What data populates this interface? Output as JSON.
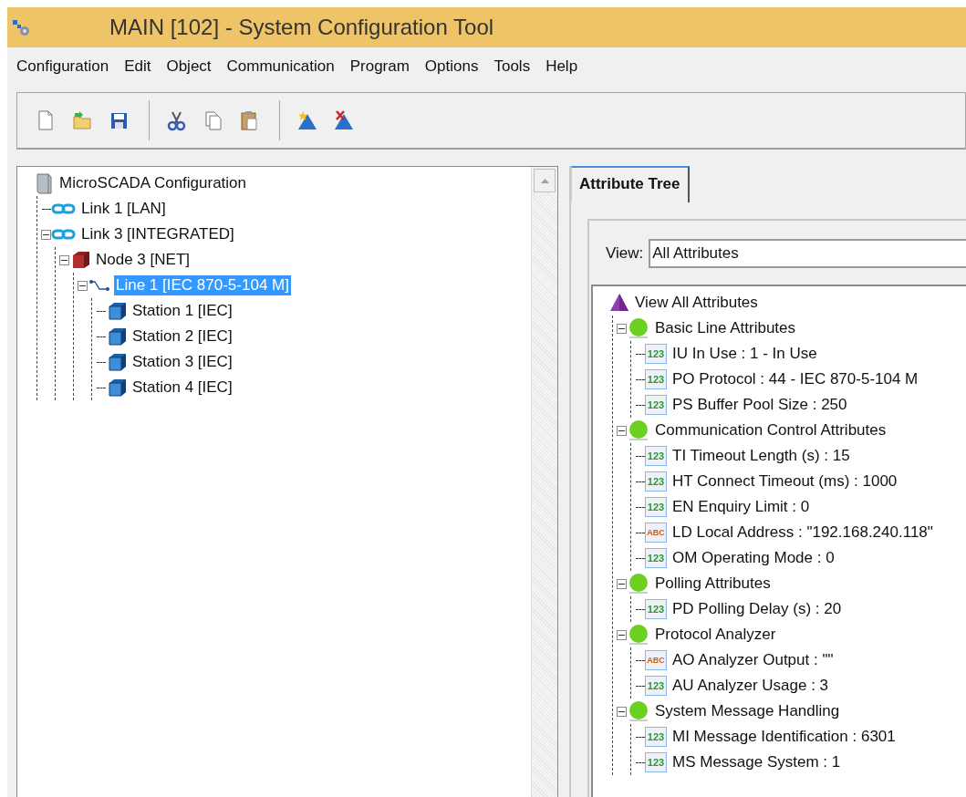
{
  "window": {
    "title": "MAIN [102] - System Configuration Tool"
  },
  "menu": [
    {
      "label": "Configuration"
    },
    {
      "label": "Edit"
    },
    {
      "label": "Object"
    },
    {
      "label": "Communication"
    },
    {
      "label": "Program"
    },
    {
      "label": "Options"
    },
    {
      "label": "Tools"
    },
    {
      "label": "Help"
    }
  ],
  "toolbar": [
    {
      "kind": "new"
    },
    {
      "kind": "open"
    },
    {
      "kind": "save"
    },
    {
      "kind": "separator"
    },
    {
      "kind": "cut"
    },
    {
      "kind": "copy"
    },
    {
      "kind": "paste"
    },
    {
      "kind": "separator"
    },
    {
      "kind": "add"
    },
    {
      "kind": "delete"
    }
  ],
  "config_tree": [
    {
      "label": "MicroSCADA Configuration",
      "kind": "computer",
      "selected": false,
      "children": [
        {
          "label": "Link 1 [LAN]",
          "kind": "link",
          "selected": false
        },
        {
          "label": "Link 3 [INTEGRATED]",
          "kind": "link",
          "selected": false,
          "expanded": true,
          "children": [
            {
              "label": "Node 3 [NET]",
              "kind": "node",
              "selected": false,
              "expanded": true,
              "children": [
                {
                  "label": "Line 1 [IEC 870-5-104 M]",
                  "kind": "line",
                  "selected": true,
                  "expanded": true,
                  "children": [
                    {
                      "label": "Station 1 [IEC]",
                      "kind": "station",
                      "selected": false
                    },
                    {
                      "label": "Station 2 [IEC]",
                      "kind": "station",
                      "selected": false
                    },
                    {
                      "label": "Station 3 [IEC]",
                      "kind": "station",
                      "selected": false
                    },
                    {
                      "label": "Station 4 [IEC]",
                      "kind": "station",
                      "selected": false
                    }
                  ]
                }
              ]
            }
          ]
        }
      ]
    }
  ],
  "tabs": [
    {
      "label": "Attribute Tree",
      "selected": true
    }
  ],
  "view": {
    "label": "View:",
    "value": "All Attributes"
  },
  "attribute_tree": [
    {
      "label": "View All Attributes",
      "kind": "root",
      "children": [
        {
          "label": "Basic Line Attributes",
          "kind": "group",
          "expanded": true,
          "children": [
            {
              "label": "IU In Use : 1 - In Use",
              "kind": "attribute",
              "badge": "123"
            },
            {
              "label": "PO Protocol : 44 - IEC 870-5-104 M",
              "kind": "attribute",
              "badge": "123"
            },
            {
              "label": "PS Buffer Pool Size : 250",
              "kind": "attribute",
              "badge": "123"
            }
          ]
        },
        {
          "label": "Communication Control Attributes",
          "kind": "group",
          "expanded": true,
          "children": [
            {
              "label": "TI Timeout Length (s) : 15",
              "kind": "attribute",
              "badge": "123"
            },
            {
              "label": "HT Connect Timeout (ms) : 1000",
              "kind": "attribute",
              "badge": "123"
            },
            {
              "label": "EN Enquiry Limit : 0",
              "kind": "attribute",
              "badge": "123"
            },
            {
              "label": "LD Local Address : \"192.168.240.118\"",
              "kind": "attribute",
              "badge": "ABC"
            },
            {
              "label": "OM Operating Mode : 0",
              "kind": "attribute",
              "badge": "123"
            }
          ]
        },
        {
          "label": "Polling Attributes",
          "kind": "group",
          "expanded": true,
          "children": [
            {
              "label": "PD Polling Delay (s) : 20",
              "kind": "attribute",
              "badge": "123"
            }
          ]
        },
        {
          "label": "Protocol Analyzer",
          "kind": "group",
          "expanded": true,
          "children": [
            {
              "label": "AO Analyzer Output : \"\"",
              "kind": "attribute",
              "badge": "ABC"
            },
            {
              "label": "AU Analyzer Usage : 3",
              "kind": "attribute",
              "badge": "123"
            }
          ]
        },
        {
          "label": "System Message Handling",
          "kind": "group",
          "expanded": true,
          "children": [
            {
              "label": "MI Message Identification : 6301",
              "kind": "attribute",
              "badge": "123"
            },
            {
              "label": "MS Message System : 1",
              "kind": "attribute",
              "badge": "123"
            }
          ]
        }
      ]
    }
  ]
}
